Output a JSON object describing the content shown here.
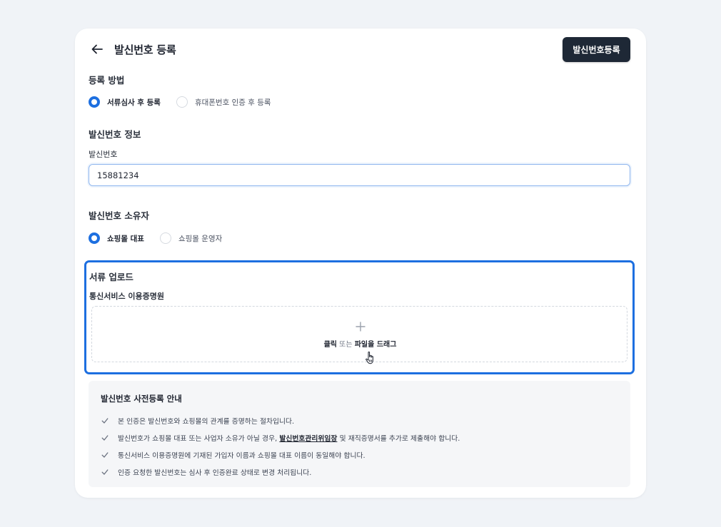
{
  "header": {
    "title": "발신번호 등록",
    "submit_label": "발신번호등록"
  },
  "registration_method": {
    "title": "등록 방법",
    "options": [
      {
        "label": "서류심사 후 등록",
        "selected": true
      },
      {
        "label": "휴대폰번호 인증 후 등록",
        "selected": false
      }
    ]
  },
  "number_info": {
    "title": "발신번호 정보",
    "field_label": "발신번호",
    "value": "15881234"
  },
  "owner": {
    "title": "발신번호 소유자",
    "options": [
      {
        "label": "쇼핑몰 대표",
        "selected": true
      },
      {
        "label": "쇼핑몰 운영자",
        "selected": false
      }
    ]
  },
  "upload": {
    "title": "서류 업로드",
    "doc_label": "통신서비스 이용증명원",
    "hint_click": "클릭",
    "hint_or": " 또는 ",
    "hint_drag": "파일을 드래그"
  },
  "notice": {
    "title": "발신번호 사전등록 안내",
    "items": [
      {
        "text": "본 인증은 발신번호와 쇼핑몰의 관계를 증명하는 절차입니다."
      },
      {
        "before": "발신번호가 쇼핑몰 대표 또는 사업자 소유가 아닐 경우, ",
        "link": "발신번호관리위임장",
        "after": " 및 재직증명서를 추가로 제출해야 합니다."
      },
      {
        "text": "통신서비스 이용증명원에 기재된 가입자 이름과 쇼핑몰 대표 이름이 동일해야 합니다."
      },
      {
        "text": "인증 요청한 발신번호는 심사 후 인증완료 상태로 변경 처리됩니다."
      }
    ]
  },
  "icons": {
    "back": "arrow-left-icon",
    "plus": "plus-icon",
    "check": "check-icon",
    "cursor": "hand-pointer-icon"
  },
  "colors": {
    "primary": "#1d6fe0",
    "dark_button": "#1e2836",
    "background": "#f0f3f7"
  }
}
